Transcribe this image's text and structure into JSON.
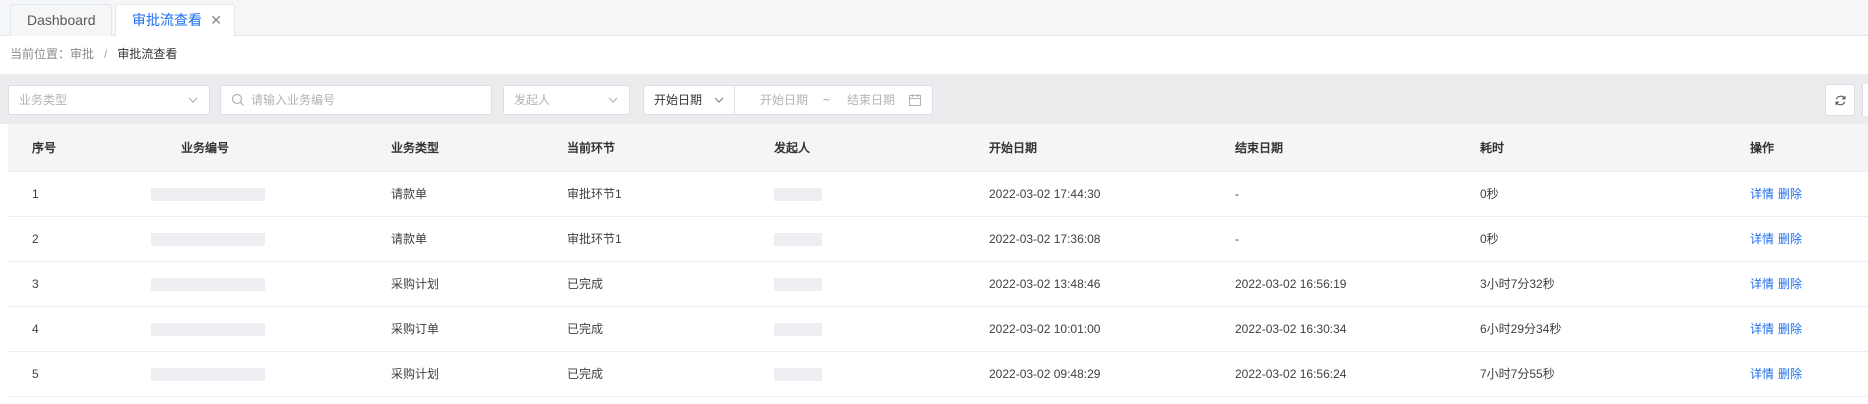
{
  "tabs": [
    {
      "label": "Dashboard",
      "active": false
    },
    {
      "label": "审批流查看",
      "active": true,
      "closable": true
    }
  ],
  "breadcrumb": {
    "prefix": "当前位置：",
    "parent": "审批",
    "separator": "/",
    "current": "审批流查看"
  },
  "filters": {
    "biz_type_placeholder": "业务类型",
    "search_placeholder": "请输入业务编号",
    "initiator_placeholder": "发起人",
    "date_type_value": "开始日期",
    "start_date_placeholder": "开始日期",
    "range_separator": "~",
    "end_date_placeholder": "结束日期"
  },
  "icons": {
    "chevron": "chevron-down-icon",
    "search": "search-icon",
    "calendar": "calendar-icon",
    "refresh": "refresh-icon",
    "close": "close-icon"
  },
  "colors": {
    "accent": "#1f6ff0",
    "header_bg": "#f4f5f7",
    "filter_bg": "#ebecee"
  },
  "table": {
    "columns": [
      "序号",
      "业务编号",
      "业务类型",
      "当前环节",
      "发起人",
      "开始日期",
      "结束日期",
      "耗时",
      "操作"
    ],
    "rows": [
      {
        "seq": "1",
        "type": "请款单",
        "node": "审批环节1",
        "start": "2022-03-02 17:44:30",
        "end": "-",
        "duration": "0秒"
      },
      {
        "seq": "2",
        "type": "请款单",
        "node": "审批环节1",
        "start": "2022-03-02 17:36:08",
        "end": "-",
        "duration": "0秒"
      },
      {
        "seq": "3",
        "type": "采购计划",
        "node": "已完成",
        "start": "2022-03-02 13:48:46",
        "end": "2022-03-02 16:56:19",
        "duration": "3小时7分32秒"
      },
      {
        "seq": "4",
        "type": "采购订单",
        "node": "已完成",
        "start": "2022-03-02 10:01:00",
        "end": "2022-03-02 16:30:34",
        "duration": "6小时29分34秒"
      },
      {
        "seq": "5",
        "type": "采购计划",
        "node": "已完成",
        "start": "2022-03-02 09:48:29",
        "end": "2022-03-02 16:56:24",
        "duration": "7小时7分55秒"
      }
    ],
    "actions": {
      "detail": "详情",
      "delete": "删除"
    }
  }
}
